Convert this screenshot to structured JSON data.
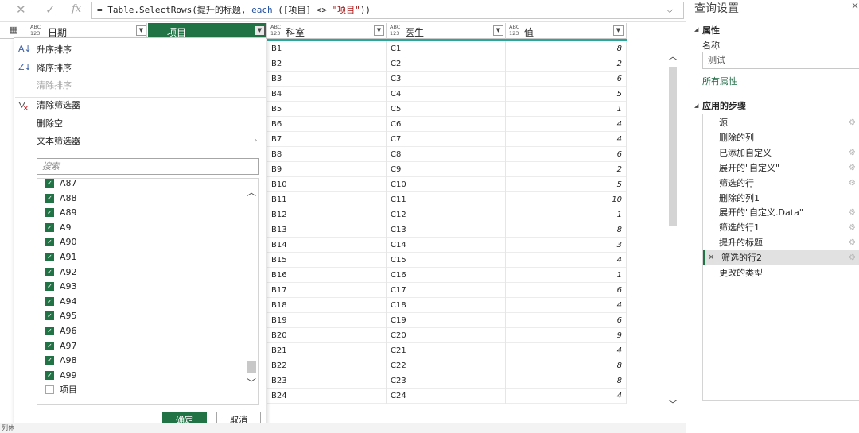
{
  "formula_bar": {
    "cancel_icon": "close-icon",
    "commit_icon": "check-icon",
    "fx_label": "fx",
    "prefix": "= Table.SelectRows(提升的标题, ",
    "keyword": "each",
    "middle": " ([项目] <> ",
    "string": "\"项目\"",
    "suffix": "))",
    "expand_icon": "chevron-down-icon"
  },
  "columns": [
    {
      "type": "ABC\n123",
      "label": "日期"
    },
    {
      "type": "",
      "label": "项目"
    },
    {
      "type": "ABC\n123",
      "label": "科室"
    },
    {
      "type": "ABC\n123",
      "label": "医生"
    },
    {
      "type": "ABC\n123",
      "label": "值"
    }
  ],
  "rows": [
    {
      "ks": "B1",
      "ys": "C1",
      "v": "8"
    },
    {
      "ks": "B2",
      "ys": "C2",
      "v": "2"
    },
    {
      "ks": "B3",
      "ys": "C3",
      "v": "6"
    },
    {
      "ks": "B4",
      "ys": "C4",
      "v": "5"
    },
    {
      "ks": "B5",
      "ys": "C5",
      "v": "1"
    },
    {
      "ks": "B6",
      "ys": "C6",
      "v": "4"
    },
    {
      "ks": "B7",
      "ys": "C7",
      "v": "4"
    },
    {
      "ks": "B8",
      "ys": "C8",
      "v": "6"
    },
    {
      "ks": "B9",
      "ys": "C9",
      "v": "2"
    },
    {
      "ks": "B10",
      "ys": "C10",
      "v": "5"
    },
    {
      "ks": "B11",
      "ys": "C11",
      "v": "10"
    },
    {
      "ks": "B12",
      "ys": "C12",
      "v": "1"
    },
    {
      "ks": "B13",
      "ys": "C13",
      "v": "8"
    },
    {
      "ks": "B14",
      "ys": "C14",
      "v": "3"
    },
    {
      "ks": "B15",
      "ys": "C15",
      "v": "4"
    },
    {
      "ks": "B16",
      "ys": "C16",
      "v": "1"
    },
    {
      "ks": "B17",
      "ys": "C17",
      "v": "6"
    },
    {
      "ks": "B18",
      "ys": "C18",
      "v": "4"
    },
    {
      "ks": "B19",
      "ys": "C19",
      "v": "6"
    },
    {
      "ks": "B20",
      "ys": "C20",
      "v": "9"
    },
    {
      "ks": "B21",
      "ys": "C21",
      "v": "4"
    },
    {
      "ks": "B22",
      "ys": "C22",
      "v": "8"
    },
    {
      "ks": "B23",
      "ys": "C23",
      "v": "8"
    },
    {
      "ks": "B24",
      "ys": "C24",
      "v": "4"
    }
  ],
  "filter_menu": {
    "sort_asc": "升序排序",
    "sort_desc": "降序排序",
    "clear_sort": "清除排序",
    "clear_filter": "清除筛选器",
    "remove_empty": "删除空",
    "text_filters": "文本筛选器",
    "search_placeholder": "搜索",
    "items": [
      {
        "label": "A87",
        "checked": true
      },
      {
        "label": "A88",
        "checked": true
      },
      {
        "label": "A89",
        "checked": true
      },
      {
        "label": "A9",
        "checked": true
      },
      {
        "label": "A90",
        "checked": true
      },
      {
        "label": "A91",
        "checked": true
      },
      {
        "label": "A92",
        "checked": true
      },
      {
        "label": "A93",
        "checked": true
      },
      {
        "label": "A94",
        "checked": true
      },
      {
        "label": "A95",
        "checked": true
      },
      {
        "label": "A96",
        "checked": true
      },
      {
        "label": "A97",
        "checked": true
      },
      {
        "label": "A98",
        "checked": true
      },
      {
        "label": "A99",
        "checked": true
      },
      {
        "label": "项目",
        "checked": false
      }
    ],
    "ok": "确定",
    "cancel": "取消"
  },
  "query_settings": {
    "title": "查询设置",
    "properties_heading": "属性",
    "name_label": "名称",
    "name_value": "测试",
    "all_properties": "所有属性",
    "applied_steps_heading": "应用的步骤",
    "steps": [
      {
        "label": "源",
        "gear": true,
        "selected": false
      },
      {
        "label": "删除的列",
        "gear": false,
        "selected": false
      },
      {
        "label": "已添加自定义",
        "gear": true,
        "selected": false
      },
      {
        "label": "展开的\"自定义\"",
        "gear": true,
        "selected": false
      },
      {
        "label": "筛选的行",
        "gear": true,
        "selected": false
      },
      {
        "label": "删除的列1",
        "gear": false,
        "selected": false
      },
      {
        "label": "展开的\"自定义.Data\"",
        "gear": true,
        "selected": false
      },
      {
        "label": "筛选的行1",
        "gear": true,
        "selected": false
      },
      {
        "label": "提升的标题",
        "gear": true,
        "selected": false
      },
      {
        "label": "筛选的行2",
        "gear": true,
        "selected": true
      },
      {
        "label": "更改的类型",
        "gear": false,
        "selected": false
      }
    ]
  },
  "status_bar": {
    "text": "列休"
  },
  "colors": {
    "accent_green": "#217346",
    "quality_bar": "#2aa79a",
    "selected_step_bg": "#e1e1e1"
  }
}
